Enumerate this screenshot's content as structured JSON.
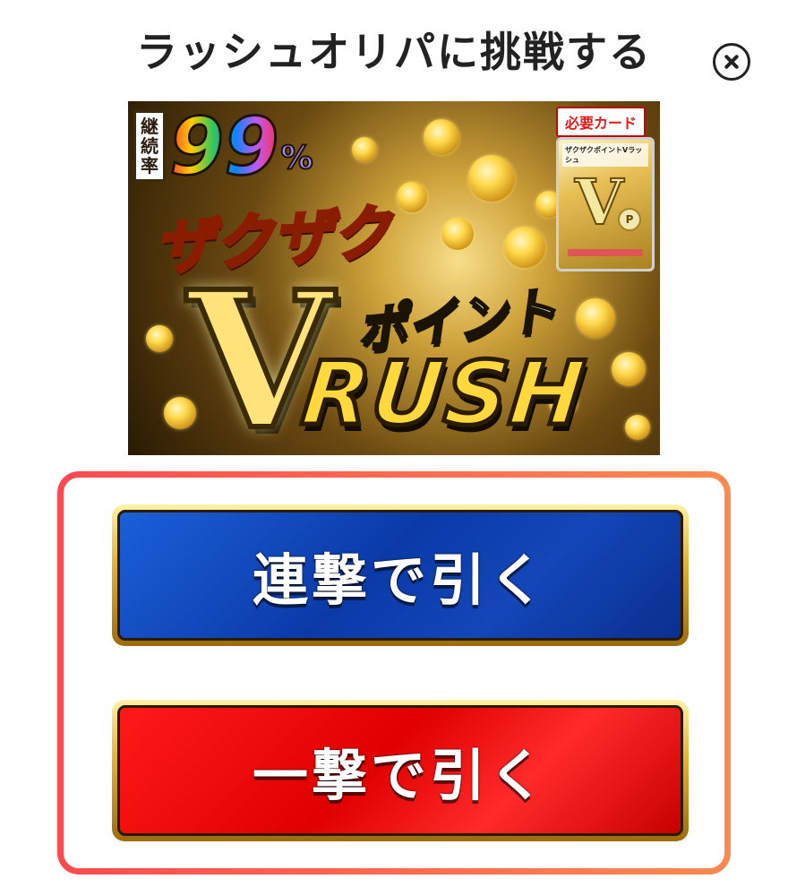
{
  "header": {
    "title": "ラッシュオリパに挑戦する"
  },
  "banner": {
    "rate_label": "継続率",
    "rate_value": "99",
    "rate_unit": "%",
    "zagzag": "ザクザク",
    "big_v": "V",
    "point": "ポイント",
    "rush": "RUSH",
    "required_card_label": "必要カード",
    "card_name": "ザクザクポイントVラッシュ",
    "card_v": "V",
    "card_p": "P"
  },
  "actions": {
    "multi_draw_label": "連撃で引く",
    "single_draw_label": "一撃で引く"
  },
  "colors": {
    "panel_border_start": "#ff4a50",
    "panel_border_end": "#ff8a50",
    "multi_button": "#0b3aa8",
    "single_button": "#e00000",
    "button_frame": "#e4b43a"
  }
}
